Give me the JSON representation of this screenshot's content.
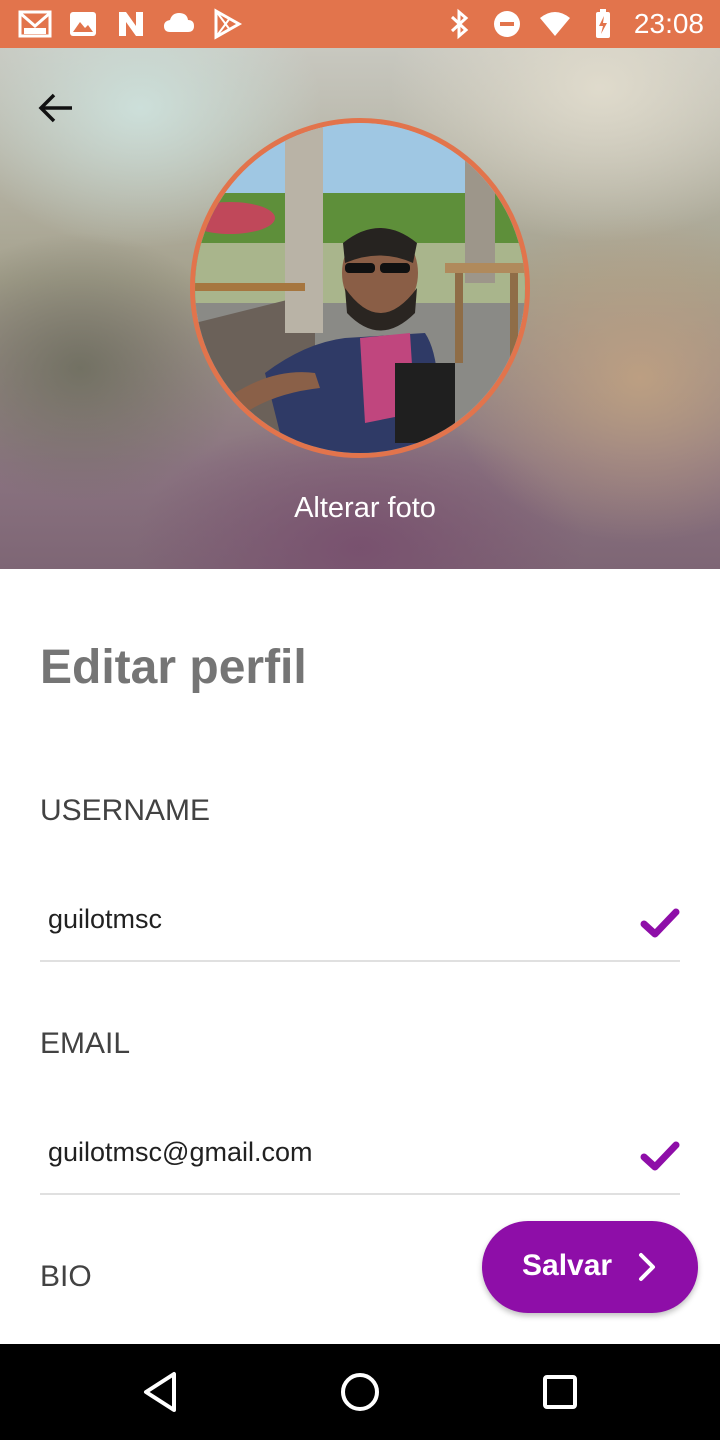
{
  "status_bar": {
    "time": "23:08",
    "left_icons": [
      "gmail-icon",
      "image-icon",
      "n-app-icon",
      "cloud-icon",
      "play-store-icon"
    ],
    "right_icons": [
      "bluetooth-icon",
      "do-not-disturb-icon",
      "wifi-icon",
      "battery-charging-icon"
    ],
    "color": "#e2744c"
  },
  "header": {
    "back_icon": "arrow-back-icon",
    "change_photo_label": "Alterar foto",
    "ring_color": "#e2744c"
  },
  "page": {
    "title": "Editar perfil"
  },
  "form": {
    "username": {
      "label": "USERNAME",
      "value": "guilotmsc",
      "valid_icon": "check-icon"
    },
    "email": {
      "label": "EMAIL",
      "value": "guilotmsc@gmail.com",
      "valid_icon": "check-icon"
    },
    "bio": {
      "label": "BIO"
    },
    "check_color": "#8e0ea8"
  },
  "save_button": {
    "label": "Salvar",
    "icon": "chevron-right-icon",
    "color": "#8e0ea8"
  },
  "nav_bar": {
    "buttons": [
      "back-triangle-icon",
      "home-circle-icon",
      "recents-square-icon"
    ]
  }
}
